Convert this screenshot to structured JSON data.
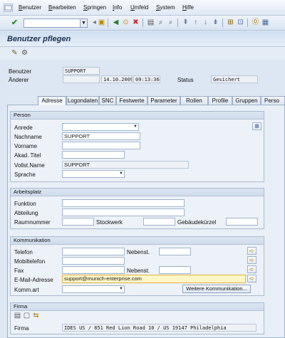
{
  "menu": {
    "items": [
      {
        "label": "Benutzer",
        "u": "B"
      },
      {
        "label": "Bearbeiten",
        "u": "B"
      },
      {
        "label": "Springen",
        "u": "S"
      },
      {
        "label": "Info",
        "u": "I"
      },
      {
        "label": "Umfeld",
        "u": "U"
      },
      {
        "label": "System",
        "u": "S"
      },
      {
        "label": "Hilfe",
        "u": "H"
      }
    ]
  },
  "title": "Benutzer pflegen",
  "header": {
    "user_label": "Benutzer",
    "user_value": "SUPPORT",
    "changed_label": "Änderer",
    "changed_date": "14.10.2009",
    "changed_time": "09:13:36",
    "status_label": "Status",
    "status_value": "Gesichert"
  },
  "tabs": [
    "Adresse",
    "Logondaten",
    "SNC",
    "Festwerte",
    "Parameter",
    "Rollen",
    "Profile",
    "Gruppen",
    "Perso"
  ],
  "person": {
    "title": "Person",
    "anrede_label": "Anrede",
    "nachname_label": "Nachname",
    "nachname_value": "SUPPORT",
    "vorname_label": "Vorname",
    "akad_label": "Akad. Titel",
    "vollst_label": "Vollst.Name",
    "vollst_value": "SUPPORT",
    "sprache_label": "Sprache"
  },
  "arbeitsplatz": {
    "title": "Arbeitsplatz",
    "funktion_label": "Funktion",
    "abteilung_label": "Abteilung",
    "raum_label": "Raumnummer",
    "stock_label": "Stockwerk",
    "geb_label": "Gebäudekürzel"
  },
  "kommunikation": {
    "title": "Kommunikation",
    "telefon_label": "Telefon",
    "nebenst_label": "Nebenst.",
    "mobil_label": "Mobiltelefon",
    "fax_label": "Fax",
    "fax_nebenst_label": "Nebenst.",
    "email_label": "E-Mail-Adresse",
    "email_value": "support@munich-enterprise.com",
    "kommart_label": "Komm.art",
    "weitere_button": "Weitere Kommunikation..."
  },
  "firma": {
    "title": "Firma",
    "firma_label": "Firma",
    "firma_value": "IDES US / 851 Red Lion Road 10 / US 19147 Philadelphia"
  },
  "colors": {
    "background": "#dde7f3",
    "email_highlight": "#fff6c8",
    "arrow_button": "#d49a00"
  }
}
